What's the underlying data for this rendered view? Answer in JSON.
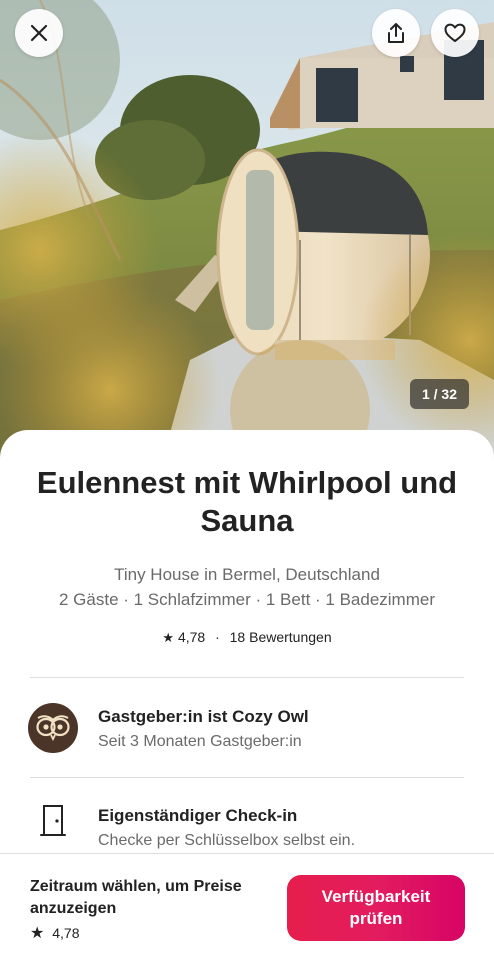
{
  "hero": {
    "photo_counter": "1 / 32",
    "icons": {
      "close": "close-icon",
      "share": "share-icon",
      "favorite": "heart-icon"
    }
  },
  "listing": {
    "title": "Eulennest mit Whirlpool und Sauna",
    "type_location": "Tiny House in Bermel, Deutschland",
    "details": "2 Gäste · 1 Schlafzimmer · 1 Bett · 1 Badezimmer",
    "rating": "4,78",
    "separator": "·",
    "reviews": "18 Bewertungen"
  },
  "host": {
    "title": "Gastgeber:in ist Cozy Owl",
    "subtitle": "Seit 3 Monaten Gastgeber:in"
  },
  "checkin": {
    "title": "Eigenständiger Check-in",
    "subtitle": "Checke per Schlüsselbox selbst ein."
  },
  "bottom_bar": {
    "price_prompt": "Zeitraum wählen, um Preise anzuzeigen",
    "rating": "4,78",
    "cta_label": "Verfügbarkeit prüfen"
  },
  "colors": {
    "accent": "#E31C5F",
    "text_primary": "#222222",
    "text_secondary": "#6A6A6A",
    "divider": "#DDDDDD"
  }
}
